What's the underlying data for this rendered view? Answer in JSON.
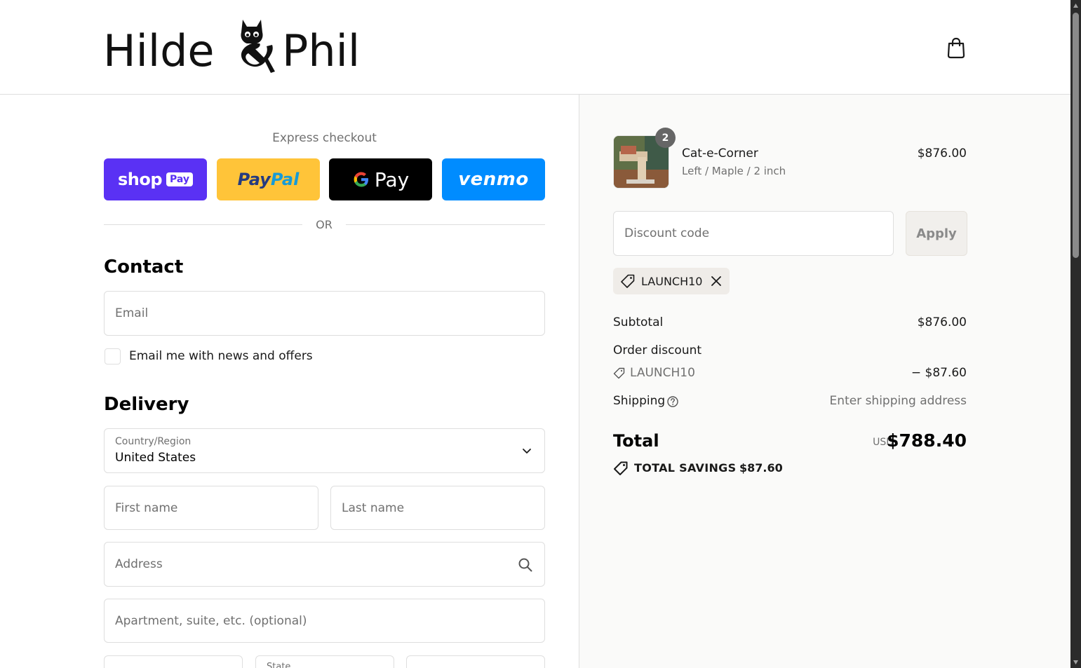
{
  "brand": {
    "name_part1": "Hilde",
    "name_part2": "Phil"
  },
  "express": {
    "title": "Express checkout",
    "shop_pay": {
      "word": "shop",
      "badge": "Pay"
    },
    "paypal": {
      "part1": "Pay",
      "part2": "Pal"
    },
    "gpay": {
      "g": "G",
      "word": "Pay"
    },
    "venmo": {
      "word": "venmo"
    },
    "or_text": "OR"
  },
  "contact": {
    "title": "Contact",
    "email_placeholder": "Email",
    "newsletter_label": "Email me with news and offers",
    "newsletter_checked": false
  },
  "delivery": {
    "title": "Delivery",
    "country_label": "Country/Region",
    "country_value": "United States",
    "first_name_placeholder": "First name",
    "last_name_placeholder": "Last name",
    "address_placeholder": "Address",
    "apartment_placeholder": "Apartment, suite, etc. (optional)",
    "state_label": "State"
  },
  "order": {
    "item": {
      "name": "Cat-e-Corner",
      "variant": "Left / Maple / 2 inch",
      "price": "$876.00",
      "quantity": "2"
    },
    "discount_placeholder": "Discount code",
    "apply_label": "Apply",
    "applied_code": "LAUNCH10",
    "subtotal_label": "Subtotal",
    "subtotal_value": "$876.00",
    "order_discount_label": "Order discount",
    "discount_code": "LAUNCH10",
    "discount_value": "− $87.60",
    "shipping_label": "Shipping",
    "shipping_value": "Enter shipping address",
    "total_label": "Total",
    "total_currency": "USD",
    "total_value": "$788.40",
    "savings_label": "TOTAL SAVINGS",
    "savings_value": "$87.60"
  },
  "colors": {
    "shop_pay": "#5a31f4",
    "paypal": "#ffc439",
    "gpay": "#000000",
    "venmo": "#008cff",
    "summary_bg": "#fafaf9"
  },
  "icons": [
    "cart-icon",
    "chevron-down-icon",
    "search-icon",
    "tag-icon",
    "close-icon",
    "question-icon"
  ]
}
